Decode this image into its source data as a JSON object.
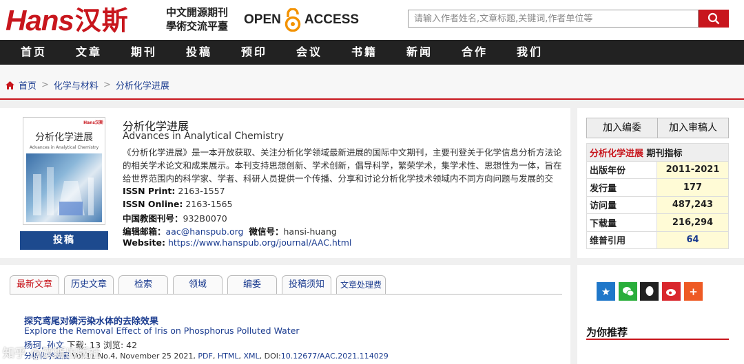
{
  "header": {
    "logo_latin": "Hans",
    "logo_cn": "汉斯",
    "slogan_line1": "中文開源期刊",
    "slogan_line2": "學術交流平臺",
    "oa_left": "OPEN",
    "oa_right": "ACCESS",
    "search_placeholder": "请输入作者姓名,文章标题,关键词,作者单位等"
  },
  "nav": [
    "首页",
    "文章",
    "期刊",
    "投稿",
    "预印",
    "会议",
    "书籍",
    "新闻",
    "合作",
    "我们"
  ],
  "breadcrumb": [
    "首页",
    "化学与材料",
    "分析化学进展"
  ],
  "journal": {
    "cover_title": "分析化学进展",
    "cover_sub": "Advances in Analytical Chemistry",
    "cover_logo": "Hans汉斯",
    "submit": "投稿",
    "title_cn": "分析化学进展",
    "title_en": "Advances in Analytical Chemistry",
    "description": "《分析化学进展》是一本开放获取、关注分析化学领域最新进展的国际中文期刊，主要刊登关于化学信息分析方法论的相关学术论文和成果展示。本刊支持思想创新、学术创新，倡导科学，繁荣学术，集学术性、思想性为一体，旨在给世界范围内的科学家、学者、科研人员提供一个传播、分享和讨论分析化学技术领域内不同方向问题与发展的交流...",
    "issn_print_label": "ISSN Print:",
    "issn_print": "2163-1557",
    "issn_online_label": "ISSN Online:",
    "issn_online": "2163-1565",
    "cn_label": "中国教图刊号：",
    "cn_code": "932B0070",
    "email_label": "编辑邮箱：",
    "email": "aac@hanspub.org",
    "wechat_label": "微信号：",
    "wechat": "hansi-huang",
    "website_label": "Website:",
    "website": "https://www.hanspub.org/journal/AAC.html"
  },
  "side": {
    "join_editor": "加入编委",
    "join_reviewer": "加入审稿人",
    "metrics_title_red": "分析化学进展",
    "metrics_title": "期刊指标",
    "metrics": [
      {
        "k": "出版年份",
        "v": "2011-2021"
      },
      {
        "k": "发行量",
        "v": "177"
      },
      {
        "k": "访问量",
        "v": "487,243"
      },
      {
        "k": "下载量",
        "v": "216,294"
      },
      {
        "k": "维普引用",
        "v": "64"
      }
    ]
  },
  "tabs": [
    "最新文章",
    "历史文章",
    "检索",
    "领域",
    "编委",
    "投稿须知",
    "文章处理费"
  ],
  "article": {
    "title_cn": "探究鸢尾对磷污染水体的去除效果",
    "title_en": "Explore the Removal Effect of Iris on Phosphorus Polluted Water",
    "authors": "杨珂, 孙文",
    "stats": "下载: 13  浏览: 42",
    "journal": "分析化学进展",
    "meta": "Vol.11 No.4, November 25 2021,",
    "pdf": "PDF",
    "html": "HTML",
    "xml": "XML",
    "doi_label": "DOI:",
    "doi": "10.12677/AAC.2021.114029"
  },
  "recommend": "为你推荐",
  "watermark": "知乎 @汉斯出版社",
  "colors": {
    "brand_red": "#c8161d",
    "nav_bg": "#222222",
    "link_blue": "#1a3b8f"
  }
}
